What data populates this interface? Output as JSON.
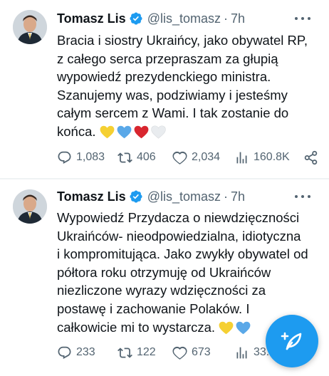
{
  "tweets": [
    {
      "author_name": "Tomasz Lis",
      "handle": "@lis_tomasz",
      "separator": "·",
      "time": "7h",
      "text_lines": [
        "Bracia i siostry Ukraińcy, jako obywatel RP,",
        "z całego serca przepraszam za głupią",
        "wypowiedź prezydenckiego ministra.",
        "Szanujemy was, podziwiamy i jesteśmy",
        "całym sercem z Wami. I tak zostanie do",
        "końca."
      ],
      "emojis": [
        "yellow-heart",
        "blue-heart",
        "red-heart",
        "white-heart"
      ],
      "stats": {
        "replies": "1,083",
        "retweets": "406",
        "likes": "2,034",
        "views": "160.8K"
      }
    },
    {
      "author_name": "Tomasz Lis",
      "handle": "@lis_tomasz",
      "separator": "·",
      "time": "7h",
      "text_lines": [
        "Wypowiedź Przydacza o niewdzięczności",
        "Ukraińców- nieodpowiedzialna, idiotyczna",
        "i kompromitująca. Jako zwykły obywatel od",
        "półtora roku otrzymuję od Ukraińców",
        "niezliczone wyrazy wdzięczności za",
        "postawę i zachowanie Polaków. I",
        "całkowicie mi to wystarcza."
      ],
      "emojis": [
        "yellow-heart",
        "blue-heart"
      ],
      "stats": {
        "replies": "233",
        "retweets": "122",
        "likes": "673",
        "views": "33..."
      }
    }
  ],
  "colors": {
    "accent": "#1d9bf0",
    "text": "#0f1419",
    "muted": "#536471",
    "yellow_heart": "#f5d032",
    "blue_heart": "#5aa8e8",
    "red_heart": "#d8262f",
    "white_heart": "#e9ecef"
  },
  "icons": {
    "reply": "reply-icon",
    "retweet": "retweet-icon",
    "like": "like-icon",
    "views": "views-icon",
    "share": "share-icon",
    "verified": "verified-badge-icon",
    "more": "more-options-icon",
    "compose": "compose-icon"
  }
}
